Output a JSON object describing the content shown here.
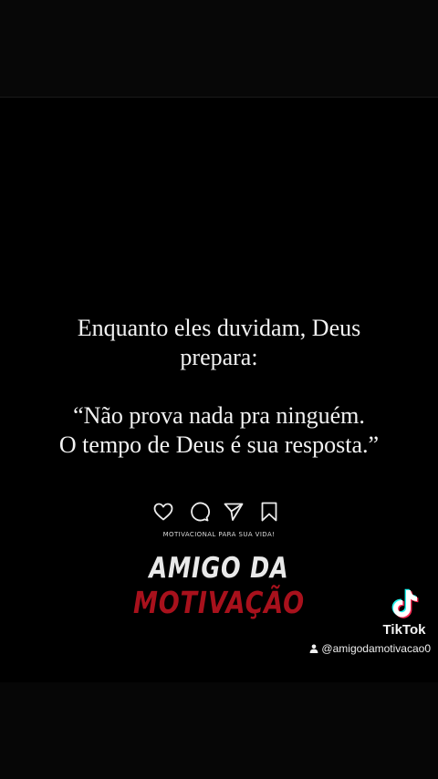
{
  "quote": {
    "intro_line1": "Enquanto eles duvidam, Deus",
    "intro_line2": "prepara:",
    "body_line1": "“Não prova nada pra ninguém.",
    "body_line2": "O tempo de Deus é sua resposta.”"
  },
  "icons": [
    "heart-icon",
    "comment-icon",
    "send-icon",
    "bookmark-icon"
  ],
  "tagline": "MOTIVACIONAL PARA SUA VIDA!",
  "brand": {
    "line1": "AMIGO DA",
    "line2": "MOTIVAÇÃO",
    "line1_color": "#e9e9e9",
    "line2_color": "#a8111c"
  },
  "watermark": {
    "app_name": "TikTok",
    "handle": "@amigodamotivacao0"
  }
}
